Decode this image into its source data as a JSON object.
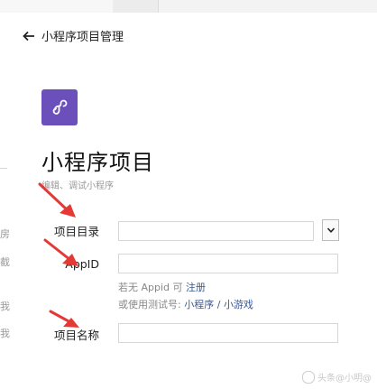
{
  "nav": {
    "back_label": "小程序项目管理"
  },
  "header": {
    "title": "小程序项目",
    "subtitle": "编辑、调试小程序"
  },
  "form": {
    "dir_label": "项目目录",
    "dir_value": "",
    "appid_label": "AppID",
    "appid_value": "",
    "name_label": "项目名称",
    "name_value": "",
    "hint_prefix": "若无 Appid 可",
    "hint_register": "注册",
    "hint2_prefix": "或使用测试号:",
    "hint2_mini": "小程序",
    "hint2_sep": "/",
    "hint2_game": "小游戏"
  },
  "left_fragments": [
    "房",
    "截",
    "我",
    "我"
  ],
  "watermark": {
    "text": "头条@小明@"
  },
  "colors": {
    "logo_bg": "#6b4fbb",
    "annotation_arrow": "#e53935",
    "link": "#3a5a9a"
  }
}
